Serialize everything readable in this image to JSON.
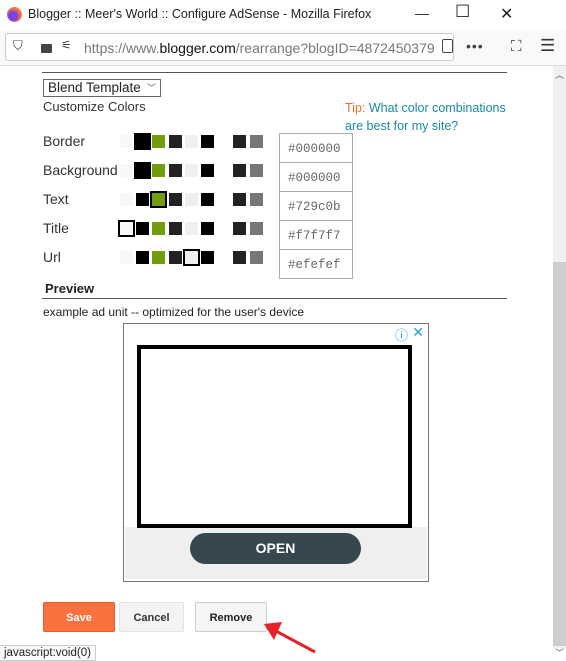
{
  "window": {
    "title": "Blogger :: Meer's World :: Configure AdSense - Mozilla Firefox",
    "minimize": "—",
    "maximize": "☐",
    "close": "✕"
  },
  "browser": {
    "url_prefix": "https://www.",
    "url_domain": "blogger.com",
    "url_rest": "/rearrange?blogID=4872450379"
  },
  "form": {
    "template_select": "Blend Template",
    "customize_label": "Customize Colors",
    "tip_label": "Tip:",
    "tip_link": "What color combinations are best for my site?",
    "palette": [
      "#f7f7f7",
      "#000000",
      "#729c0b",
      "#222222",
      "#efefef",
      "#000000",
      "#ffffff",
      "#222222",
      "#777777"
    ],
    "rows": [
      {
        "label": "Border",
        "value": "#000000",
        "selected": 1
      },
      {
        "label": "Background",
        "value": "#000000",
        "selected": 1
      },
      {
        "label": "Text",
        "value": "#729c0b",
        "selected": 2
      },
      {
        "label": "Title",
        "value": "#f7f7f7",
        "selected": 0
      },
      {
        "label": "Url",
        "value": "#efefef",
        "selected": 4
      }
    ],
    "preview_heading": "Preview",
    "preview_caption": "example ad unit -- optimized for the user's device",
    "ad_open": "OPEN",
    "save": "Save",
    "cancel": "Cancel",
    "remove": "Remove"
  },
  "status_bar": "javascript:void(0)",
  "colors": {
    "accent": "#f8713f",
    "tip": "#e8702a",
    "link": "#1a8a9e",
    "annotation_arrow": "#e3222a"
  }
}
